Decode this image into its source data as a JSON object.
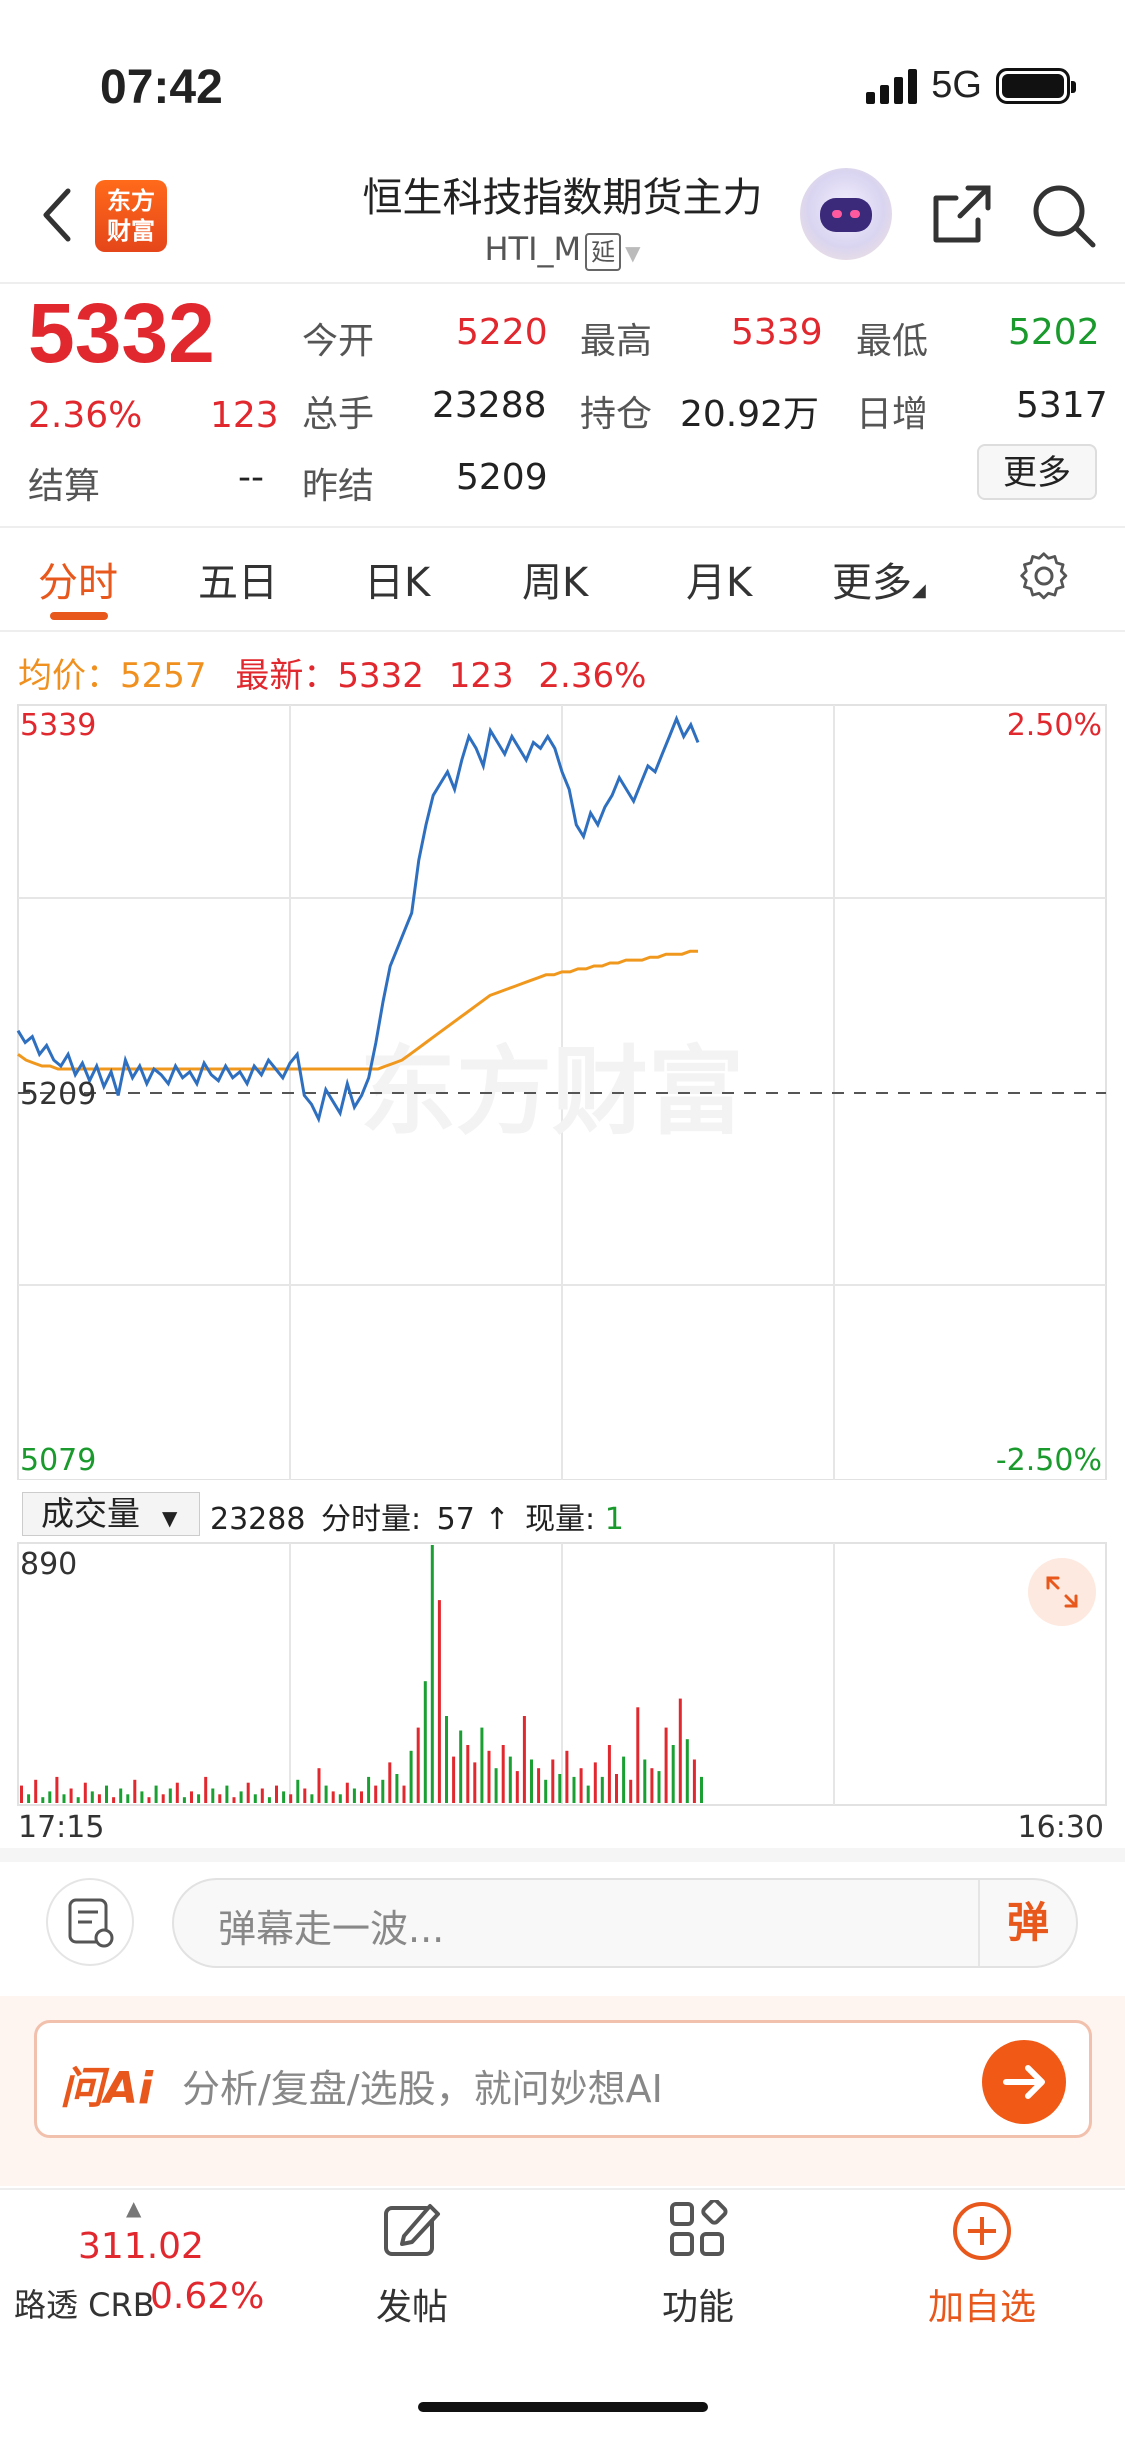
{
  "status_bar": {
    "time": "07:42",
    "network": "5G"
  },
  "header": {
    "logo_line1": "东方",
    "logo_line2": "财富",
    "title": "恒生科技指数期货主力",
    "code": "HTI_M",
    "delay_tag": "延"
  },
  "quote": {
    "last_price": "5332",
    "change_pct": "2.36%",
    "change": "123",
    "rows": [
      [
        {
          "label": "今开",
          "value": "5220",
          "color": "#e0282e"
        },
        {
          "label": "最高",
          "value": "5339",
          "color": "#e0282e"
        },
        {
          "label": "最低",
          "value": "5202",
          "color": "#1a9a2c"
        }
      ],
      [
        {
          "label": "总手",
          "value": "23288",
          "color": "#222222"
        },
        {
          "label": "持仓",
          "value": "20.92万",
          "color": "#222222"
        },
        {
          "label": "日增",
          "value": "5317",
          "color": "#222222"
        }
      ]
    ],
    "settle_label": "结算",
    "settle_value": "--",
    "prev_settle_label": "昨结",
    "prev_settle_value": "5209",
    "more_button": "更多"
  },
  "tabs": [
    "分时",
    "五日",
    "日K",
    "周K",
    "月K",
    "更多"
  ],
  "chart_info": {
    "avg_label": "均价：",
    "avg_value": "5257",
    "latest_label": "最新：",
    "latest_value": "5332",
    "latest_change": "123",
    "latest_pct": "2.36%"
  },
  "chart_data": {
    "type": "line",
    "price_axis": {
      "max": "5339",
      "mid": "5209",
      "min": "5079",
      "max_pct": "2.50%",
      "min_pct": "-2.50%"
    },
    "watermark": "东方财富",
    "ylim": [
      5079,
      5339
    ],
    "reference": 5209,
    "series": [
      {
        "values": [
          5230,
          5226,
          5228,
          5222,
          5225,
          5220,
          5218,
          5222,
          5215,
          5219,
          5213,
          5218,
          5211,
          5216,
          5208,
          5220,
          5214,
          5218,
          5212,
          5217,
          5215,
          5212,
          5218,
          5214,
          5216,
          5212,
          5219,
          5215,
          5213,
          5218,
          5214,
          5216,
          5212,
          5218,
          5215,
          5220,
          5217,
          5214,
          5219,
          5222,
          5208,
          5205,
          5200,
          5210,
          5206,
          5202,
          5212,
          5204,
          5208,
          5214,
          5226,
          5240,
          5252,
          5258,
          5264,
          5270,
          5288,
          5300,
          5310,
          5314,
          5318,
          5312,
          5322,
          5330,
          5326,
          5320,
          5332,
          5328,
          5324,
          5330,
          5326,
          5322,
          5328,
          5326,
          5330,
          5326,
          5318,
          5312,
          5300,
          5296,
          5304,
          5300,
          5306,
          5310,
          5316,
          5312,
          5308,
          5314,
          5320,
          5318,
          5324,
          5330,
          5336,
          5330,
          5334,
          5328
        ]
      },
      {
        "values": [
          5222,
          5220,
          5219,
          5218,
          5218,
          5217,
          5217,
          5217,
          5217,
          5217,
          5217,
          5217,
          5217,
          5217,
          5217,
          5217,
          5217,
          5217,
          5217,
          5217,
          5217,
          5217,
          5217,
          5217,
          5217,
          5217,
          5217,
          5217,
          5217,
          5217,
          5217,
          5217,
          5217,
          5217,
          5217,
          5217,
          5217,
          5217,
          5217,
          5217,
          5217,
          5217,
          5217,
          5217,
          5217,
          5217,
          5218,
          5219,
          5220,
          5222,
          5224,
          5226,
          5228,
          5230,
          5232,
          5234,
          5236,
          5238,
          5240,
          5242,
          5243,
          5244,
          5245,
          5246,
          5247,
          5248,
          5249,
          5249,
          5250,
          5250,
          5251,
          5251,
          5252,
          5252,
          5253,
          5253,
          5254,
          5254,
          5254,
          5255,
          5255,
          5256,
          5256,
          5256,
          5257,
          5257
        ]
      }
    ],
    "volume": {
      "max_label": "890",
      "x_start": "17:15",
      "x_end": "16:30",
      "bars": [
        60,
        30,
        80,
        20,
        40,
        90,
        30,
        50,
        20,
        70,
        40,
        30,
        60,
        20,
        50,
        30,
        80,
        40,
        20,
        60,
        30,
        50,
        70,
        20,
        40,
        30,
        90,
        50,
        30,
        60,
        20,
        40,
        70,
        30,
        50,
        20,
        60,
        40,
        30,
        80,
        50,
        30,
        120,
        60,
        40,
        30,
        70,
        50,
        40,
        90,
        60,
        80,
        140,
        100,
        60,
        180,
        260,
        420,
        890,
        700,
        300,
        160,
        250,
        200,
        140,
        260,
        180,
        120,
        200,
        160,
        110,
        300,
        150,
        120,
        80,
        150,
        100,
        180,
        90,
        120,
        60,
        140,
        90,
        200,
        100,
        160,
        80,
        330,
        150,
        120,
        110,
        260,
        200,
        360,
        220,
        150,
        90
      ],
      "colors": [
        "r",
        "g",
        "r",
        "g",
        "g",
        "r",
        "g",
        "r",
        "g",
        "r",
        "g",
        "r",
        "g",
        "r",
        "g",
        "g",
        "r",
        "g",
        "r",
        "g",
        "r",
        "g",
        "r",
        "g",
        "r",
        "g",
        "r",
        "g",
        "r",
        "g",
        "r",
        "g",
        "r",
        "g",
        "r",
        "g",
        "r",
        "g",
        "r",
        "g",
        "r",
        "g",
        "r",
        "g",
        "r",
        "g",
        "r",
        "g",
        "r",
        "g",
        "r",
        "g",
        "r",
        "g",
        "r",
        "g",
        "r",
        "g",
        "g",
        "r",
        "g",
        "r",
        "g",
        "r",
        "r",
        "g",
        "r",
        "g",
        "r",
        "g",
        "r",
        "r",
        "g",
        "r",
        "g",
        "r",
        "g",
        "r",
        "g",
        "r",
        "g",
        "r",
        "g",
        "r",
        "r",
        "g",
        "r",
        "r",
        "g",
        "r",
        "g",
        "r",
        "g",
        "r",
        "g",
        "r",
        "g"
      ]
    }
  },
  "volume_panel": {
    "selector": "成交量",
    "total": "23288",
    "minute_label": "分时量:",
    "minute_value": "57",
    "arrow": "↑",
    "current_label": "现量:",
    "current_value": "1"
  },
  "comment": {
    "placeholder": "弹幕走一波...",
    "dan": "弹"
  },
  "ai": {
    "logo": "问Ai",
    "placeholder": "分析/复盘/选股，就问妙想AI"
  },
  "bottom_nav": {
    "index_value": "311.02",
    "index_name": "路透 CRB",
    "index_pct": "0.62%",
    "post": "发帖",
    "functions": "功能",
    "add_watch": "加自选"
  }
}
